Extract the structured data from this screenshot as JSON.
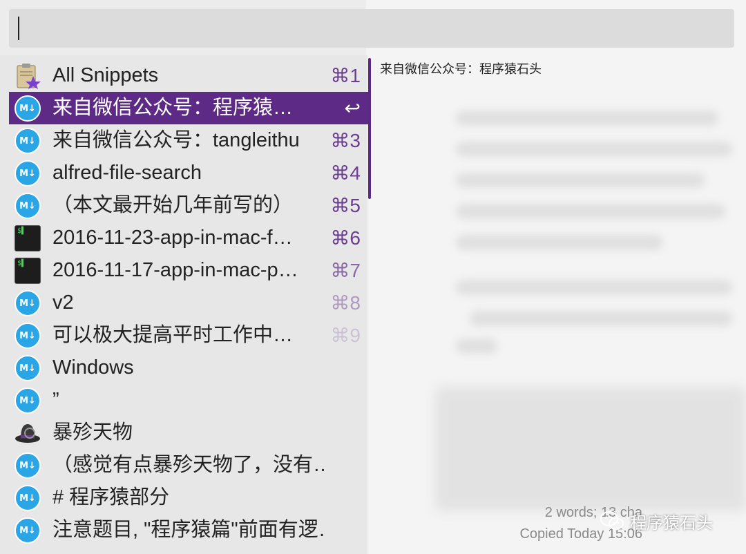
{
  "search": {
    "query": ""
  },
  "list": {
    "items": [
      {
        "label": "All Snippets",
        "shortcut": "⌘1",
        "icon": "snippets-icon"
      },
      {
        "label": "来自微信公众号：程序猿…",
        "shortcut": "↩",
        "icon": "markdown-icon",
        "selected": true
      },
      {
        "label": "来自微信公众号：tangleithu",
        "shortcut": "⌘3",
        "icon": "markdown-icon"
      },
      {
        "label": "alfred-file-search",
        "shortcut": "⌘4",
        "icon": "markdown-icon"
      },
      {
        "label": "（本文最开始几年前写的）",
        "shortcut": "⌘5",
        "icon": "markdown-icon"
      },
      {
        "label": "2016-11-23-app-in-mac-f…",
        "shortcut": "⌘6",
        "icon": "terminal-icon"
      },
      {
        "label": "2016-11-17-app-in-mac-p…",
        "shortcut": "⌘7",
        "icon": "terminal-icon"
      },
      {
        "label": "v2",
        "shortcut": "⌘8",
        "icon": "markdown-icon"
      },
      {
        "label": "可以极大提高平时工作中…",
        "shortcut": "⌘9",
        "icon": "markdown-icon"
      },
      {
        "label": "Windows",
        "shortcut": "",
        "icon": "markdown-icon"
      },
      {
        "label": "”",
        "shortcut": "",
        "icon": "markdown-icon"
      },
      {
        "label": "暴殄天物",
        "shortcut": "",
        "icon": "alfred-hat-icon"
      },
      {
        "label": "（感觉有点暴殄天物了，没有…",
        "shortcut": "",
        "icon": "markdown-icon"
      },
      {
        "label": "# 程序猿部分",
        "shortcut": "",
        "icon": "markdown-icon"
      },
      {
        "label": "注意题目, \"程序猿篇\"前面有逻…",
        "shortcut": "",
        "icon": "markdown-icon"
      }
    ]
  },
  "preview": {
    "title": "来自微信公众号：程序猿石头",
    "stats": "2 words; 13 cha",
    "copied": "Copied Today 15:06"
  },
  "watermark": {
    "text": "程序猿石头"
  },
  "colors": {
    "accent": "#5d2a85",
    "md_blue": "#2aa6e7"
  }
}
